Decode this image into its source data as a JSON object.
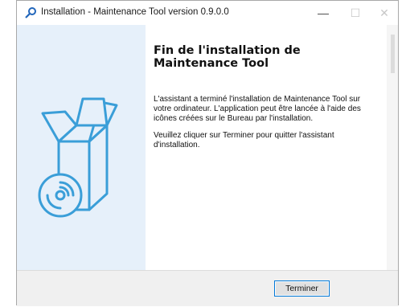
{
  "window": {
    "title": "Installation - Maintenance Tool version 0.9.0.0"
  },
  "controls": {
    "minimize": "—",
    "maximize": "☐",
    "close": "✕"
  },
  "content": {
    "heading": "Fin de l'installation de Maintenance Tool",
    "paragraph1": "L'assistant a terminé l'installation de Maintenance Tool sur votre ordinateur. L'application peut être lancée à l'aide des icônes créées sur le Bureau par l'installation.",
    "paragraph2": "Veuillez cliquer sur Terminer pour quitter l'assistant d'installation."
  },
  "footer": {
    "finish_label": "Terminer"
  },
  "colors": {
    "side_panel": "#e6f0fa",
    "illustration": "#3a9ed8",
    "button_border": "#0078d7"
  }
}
